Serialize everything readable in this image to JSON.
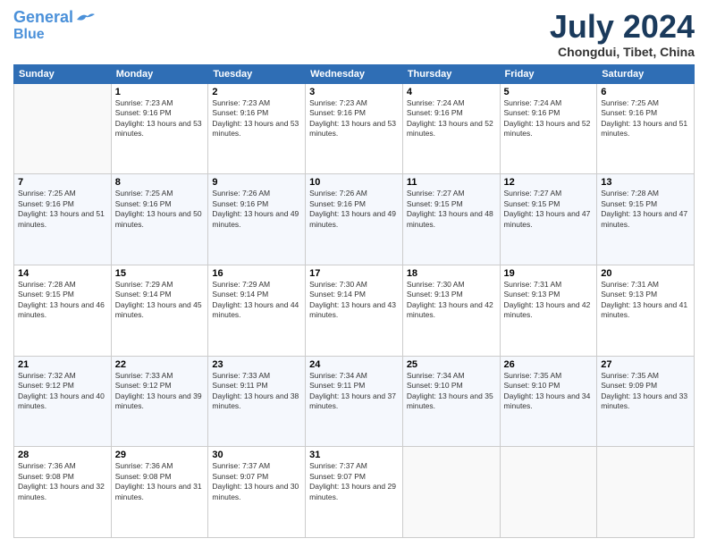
{
  "logo": {
    "line1": "General",
    "line2": "Blue"
  },
  "header": {
    "month": "July 2024",
    "location": "Chongdui, Tibet, China"
  },
  "days_of_week": [
    "Sunday",
    "Monday",
    "Tuesday",
    "Wednesday",
    "Thursday",
    "Friday",
    "Saturday"
  ],
  "weeks": [
    [
      {
        "day": "",
        "sunrise": "",
        "sunset": "",
        "daylight": ""
      },
      {
        "day": "1",
        "sunrise": "Sunrise: 7:23 AM",
        "sunset": "Sunset: 9:16 PM",
        "daylight": "Daylight: 13 hours and 53 minutes."
      },
      {
        "day": "2",
        "sunrise": "Sunrise: 7:23 AM",
        "sunset": "Sunset: 9:16 PM",
        "daylight": "Daylight: 13 hours and 53 minutes."
      },
      {
        "day": "3",
        "sunrise": "Sunrise: 7:23 AM",
        "sunset": "Sunset: 9:16 PM",
        "daylight": "Daylight: 13 hours and 53 minutes."
      },
      {
        "day": "4",
        "sunrise": "Sunrise: 7:24 AM",
        "sunset": "Sunset: 9:16 PM",
        "daylight": "Daylight: 13 hours and 52 minutes."
      },
      {
        "day": "5",
        "sunrise": "Sunrise: 7:24 AM",
        "sunset": "Sunset: 9:16 PM",
        "daylight": "Daylight: 13 hours and 52 minutes."
      },
      {
        "day": "6",
        "sunrise": "Sunrise: 7:25 AM",
        "sunset": "Sunset: 9:16 PM",
        "daylight": "Daylight: 13 hours and 51 minutes."
      }
    ],
    [
      {
        "day": "7",
        "sunrise": "Sunrise: 7:25 AM",
        "sunset": "Sunset: 9:16 PM",
        "daylight": "Daylight: 13 hours and 51 minutes."
      },
      {
        "day": "8",
        "sunrise": "Sunrise: 7:25 AM",
        "sunset": "Sunset: 9:16 PM",
        "daylight": "Daylight: 13 hours and 50 minutes."
      },
      {
        "day": "9",
        "sunrise": "Sunrise: 7:26 AM",
        "sunset": "Sunset: 9:16 PM",
        "daylight": "Daylight: 13 hours and 49 minutes."
      },
      {
        "day": "10",
        "sunrise": "Sunrise: 7:26 AM",
        "sunset": "Sunset: 9:16 PM",
        "daylight": "Daylight: 13 hours and 49 minutes."
      },
      {
        "day": "11",
        "sunrise": "Sunrise: 7:27 AM",
        "sunset": "Sunset: 9:15 PM",
        "daylight": "Daylight: 13 hours and 48 minutes."
      },
      {
        "day": "12",
        "sunrise": "Sunrise: 7:27 AM",
        "sunset": "Sunset: 9:15 PM",
        "daylight": "Daylight: 13 hours and 47 minutes."
      },
      {
        "day": "13",
        "sunrise": "Sunrise: 7:28 AM",
        "sunset": "Sunset: 9:15 PM",
        "daylight": "Daylight: 13 hours and 47 minutes."
      }
    ],
    [
      {
        "day": "14",
        "sunrise": "Sunrise: 7:28 AM",
        "sunset": "Sunset: 9:15 PM",
        "daylight": "Daylight: 13 hours and 46 minutes."
      },
      {
        "day": "15",
        "sunrise": "Sunrise: 7:29 AM",
        "sunset": "Sunset: 9:14 PM",
        "daylight": "Daylight: 13 hours and 45 minutes."
      },
      {
        "day": "16",
        "sunrise": "Sunrise: 7:29 AM",
        "sunset": "Sunset: 9:14 PM",
        "daylight": "Daylight: 13 hours and 44 minutes."
      },
      {
        "day": "17",
        "sunrise": "Sunrise: 7:30 AM",
        "sunset": "Sunset: 9:14 PM",
        "daylight": "Daylight: 13 hours and 43 minutes."
      },
      {
        "day": "18",
        "sunrise": "Sunrise: 7:30 AM",
        "sunset": "Sunset: 9:13 PM",
        "daylight": "Daylight: 13 hours and 42 minutes."
      },
      {
        "day": "19",
        "sunrise": "Sunrise: 7:31 AM",
        "sunset": "Sunset: 9:13 PM",
        "daylight": "Daylight: 13 hours and 42 minutes."
      },
      {
        "day": "20",
        "sunrise": "Sunrise: 7:31 AM",
        "sunset": "Sunset: 9:13 PM",
        "daylight": "Daylight: 13 hours and 41 minutes."
      }
    ],
    [
      {
        "day": "21",
        "sunrise": "Sunrise: 7:32 AM",
        "sunset": "Sunset: 9:12 PM",
        "daylight": "Daylight: 13 hours and 40 minutes."
      },
      {
        "day": "22",
        "sunrise": "Sunrise: 7:33 AM",
        "sunset": "Sunset: 9:12 PM",
        "daylight": "Daylight: 13 hours and 39 minutes."
      },
      {
        "day": "23",
        "sunrise": "Sunrise: 7:33 AM",
        "sunset": "Sunset: 9:11 PM",
        "daylight": "Daylight: 13 hours and 38 minutes."
      },
      {
        "day": "24",
        "sunrise": "Sunrise: 7:34 AM",
        "sunset": "Sunset: 9:11 PM",
        "daylight": "Daylight: 13 hours and 37 minutes."
      },
      {
        "day": "25",
        "sunrise": "Sunrise: 7:34 AM",
        "sunset": "Sunset: 9:10 PM",
        "daylight": "Daylight: 13 hours and 35 minutes."
      },
      {
        "day": "26",
        "sunrise": "Sunrise: 7:35 AM",
        "sunset": "Sunset: 9:10 PM",
        "daylight": "Daylight: 13 hours and 34 minutes."
      },
      {
        "day": "27",
        "sunrise": "Sunrise: 7:35 AM",
        "sunset": "Sunset: 9:09 PM",
        "daylight": "Daylight: 13 hours and 33 minutes."
      }
    ],
    [
      {
        "day": "28",
        "sunrise": "Sunrise: 7:36 AM",
        "sunset": "Sunset: 9:08 PM",
        "daylight": "Daylight: 13 hours and 32 minutes."
      },
      {
        "day": "29",
        "sunrise": "Sunrise: 7:36 AM",
        "sunset": "Sunset: 9:08 PM",
        "daylight": "Daylight: 13 hours and 31 minutes."
      },
      {
        "day": "30",
        "sunrise": "Sunrise: 7:37 AM",
        "sunset": "Sunset: 9:07 PM",
        "daylight": "Daylight: 13 hours and 30 minutes."
      },
      {
        "day": "31",
        "sunrise": "Sunrise: 7:37 AM",
        "sunset": "Sunset: 9:07 PM",
        "daylight": "Daylight: 13 hours and 29 minutes."
      },
      {
        "day": "",
        "sunrise": "",
        "sunset": "",
        "daylight": ""
      },
      {
        "day": "",
        "sunrise": "",
        "sunset": "",
        "daylight": ""
      },
      {
        "day": "",
        "sunrise": "",
        "sunset": "",
        "daylight": ""
      }
    ]
  ]
}
